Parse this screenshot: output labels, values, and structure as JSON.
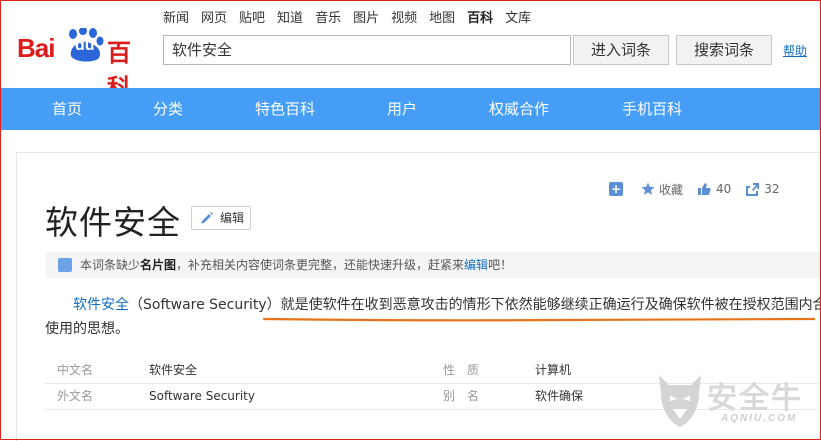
{
  "logo": {
    "bai": "Bai",
    "du": "du",
    "baike": "百科"
  },
  "topnav": [
    "新闻",
    "网页",
    "贴吧",
    "知道",
    "音乐",
    "图片",
    "视频",
    "地图",
    "百科",
    "文库"
  ],
  "topnav_active": "百科",
  "search": {
    "value": "软件安全",
    "enter_button": "进入词条",
    "search_button": "搜索词条",
    "help": "帮助"
  },
  "bluebar": [
    "首页",
    "分类",
    "特色百科",
    "用户",
    "权威合作",
    "手机百科"
  ],
  "actions": {
    "collect": "收藏",
    "likes": "40",
    "shares": "32"
  },
  "entry": {
    "title": "软件安全",
    "edit": "编辑"
  },
  "notice": {
    "pre": "本词条缺少",
    "bold": "名片图",
    "mid": "，补充相关内容使词条更完整，还能快速升级，赶紧来",
    "link": "编辑",
    "post": "吧！"
  },
  "summary": {
    "link": "软件安全",
    "paren": "（Software Security）",
    "line1_rest": "就是使软件在收到恶意攻击的情形下依然能够继续正确运行及确保软件被在授权范围内合法",
    "line2": "使用的思想。"
  },
  "info": [
    {
      "k1": "中文名",
      "v1": "软件安全",
      "k2": "性　质",
      "v2": "计算机"
    },
    {
      "k1": "外文名",
      "v1": "Software Security",
      "k2": "别　名",
      "v2": "软件确保"
    }
  ],
  "watermark": {
    "text": "安全牛",
    "sub": "AQNIU.COM"
  },
  "colors": {
    "accent": "#459df5",
    "brand_red": "#de1b1b",
    "link": "#136ec2",
    "underline": "#e8741a"
  }
}
